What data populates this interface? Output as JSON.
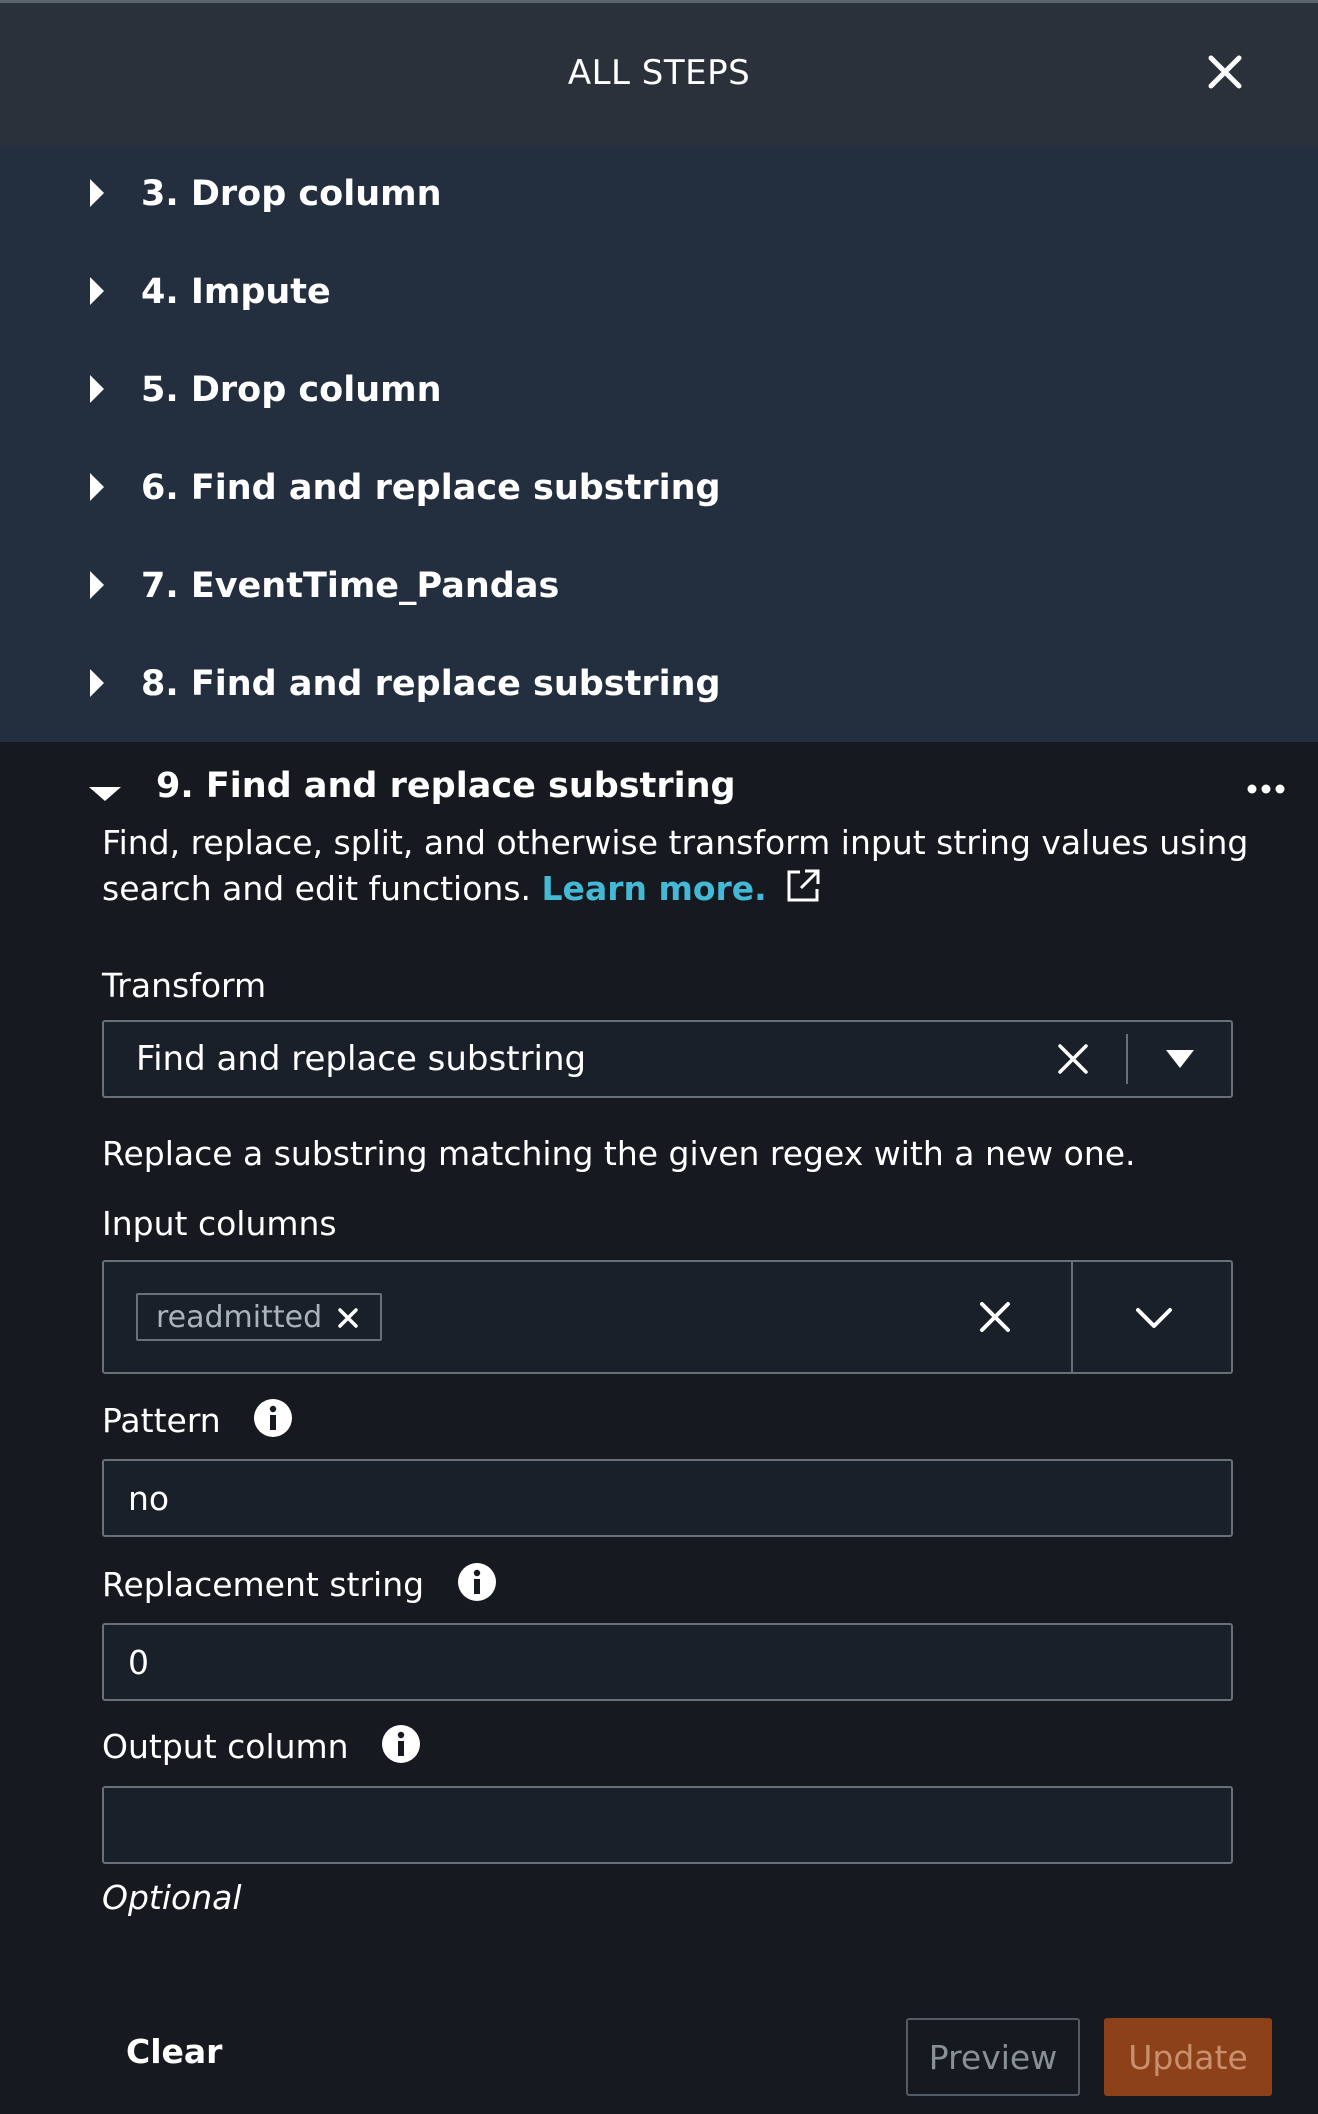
{
  "header": {
    "title": "ALL STEPS",
    "close_icon": "close-icon"
  },
  "steps": [
    {
      "label": "3. Drop column"
    },
    {
      "label": "4. Impute"
    },
    {
      "label": "5. Drop column"
    },
    {
      "label": "6. Find and replace substring"
    },
    {
      "label": "7. EventTime_Pandas"
    },
    {
      "label": "8. Find and replace substring"
    }
  ],
  "expanded_step": {
    "title": "9. Find and replace substring",
    "description": "Find, replace, split, and otherwise transform input string values using search and edit functions.",
    "learn_more": "Learn more.",
    "transform": {
      "label": "Transform",
      "value": "Find and replace substring"
    },
    "transform_help": "Replace a substring matching the given regex with a new one.",
    "input_columns": {
      "label": "Input columns",
      "tokens": [
        "readmitted"
      ]
    },
    "pattern": {
      "label": "Pattern",
      "value": "no"
    },
    "replacement": {
      "label": "Replacement string",
      "value": "0"
    },
    "output_column": {
      "label": "Output column",
      "value": "",
      "hint": "Optional"
    }
  },
  "footer": {
    "clear": "Clear",
    "preview": "Preview",
    "update": "Update"
  },
  "colors": {
    "header_bg": "#2a313b",
    "steps_bg": "#232f3e",
    "panel_bg": "#16191f",
    "link": "#44b9d6",
    "update_bg": "#8c4119"
  }
}
